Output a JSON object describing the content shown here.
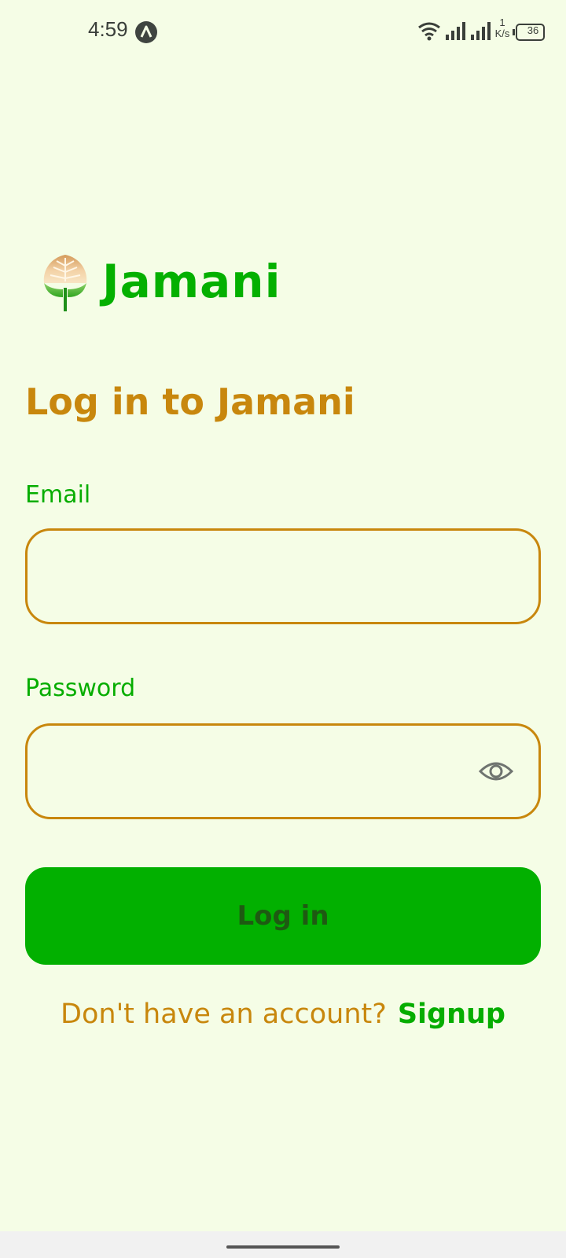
{
  "status_bar": {
    "time": "4:59",
    "app_icon": "navigation-arrow-icon",
    "net_speed_value": "1",
    "net_speed_unit": "K/s",
    "battery_level": "36"
  },
  "app": {
    "name": "Jamani",
    "logo_icon": "leaf-logo-icon",
    "brand_color": "#04b000",
    "accent_color": "#c8870d",
    "background_color": "#f5fde6"
  },
  "login": {
    "headline": "Log in to Jamani",
    "email_label": "Email",
    "email_value": "",
    "password_label": "Password",
    "password_value": "",
    "password_toggle_icon": "eye-icon",
    "submit_label": "Log in",
    "signup_prompt": "Don't have an account?",
    "signup_link": "Signup"
  }
}
